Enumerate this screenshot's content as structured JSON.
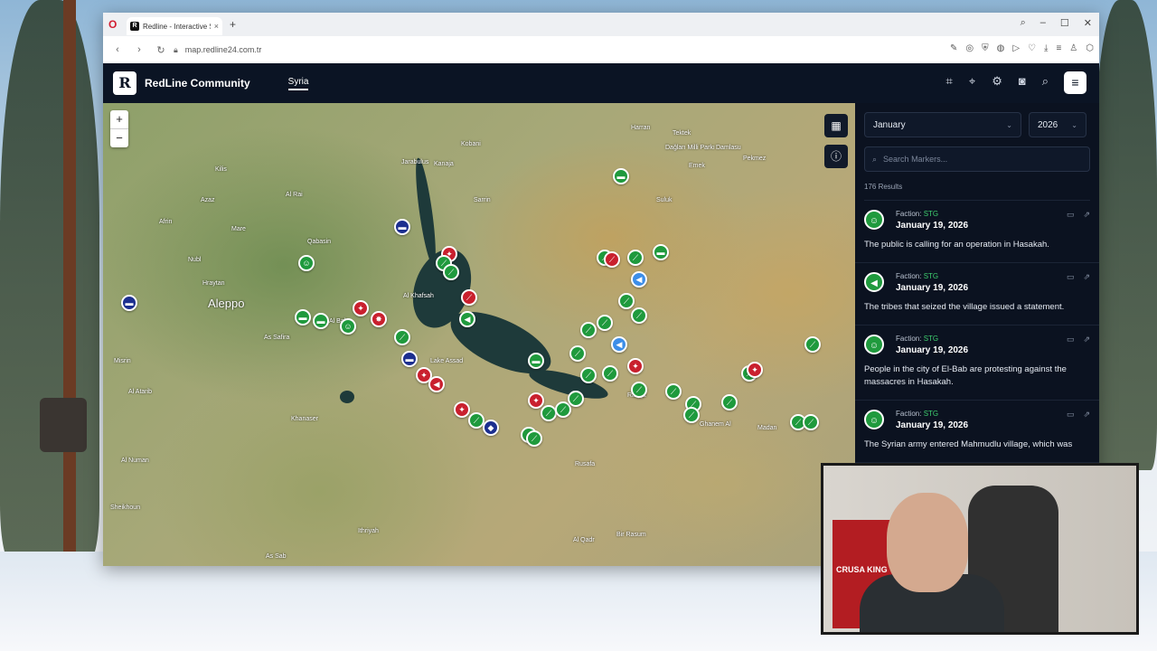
{
  "browser": {
    "tab_title": "Redline - Interactive Strat",
    "url": "map.redline24.com.tr",
    "tab_close": "×",
    "new_tab": "+"
  },
  "app": {
    "brand": "RedLine Community",
    "logo_letter": "R",
    "nav_active": "Syria",
    "map": {
      "zoom_in": "+",
      "zoom_out": "−",
      "cities": [
        {
          "name": "Aleppo",
          "size": "big"
        },
        {
          "name": "Jarabulus"
        },
        {
          "name": "Kobani"
        },
        {
          "name": "Harran"
        },
        {
          "name": "Kanaja"
        },
        {
          "name": "Sarrin"
        },
        {
          "name": "Azaz"
        },
        {
          "name": "Afrin"
        },
        {
          "name": "Kilis"
        },
        {
          "name": "Al Rai"
        },
        {
          "name": "Mare"
        },
        {
          "name": "Qabasin"
        },
        {
          "name": "Nubl"
        },
        {
          "name": "Hraytan"
        },
        {
          "name": "Al Khafsah"
        },
        {
          "name": "Lake Assad"
        },
        {
          "name": "As Safira"
        },
        {
          "name": "Khanaser"
        },
        {
          "name": "Al Bab"
        },
        {
          "name": "Raqqa"
        },
        {
          "name": "Ghanem Al"
        },
        {
          "name": "Madan"
        },
        {
          "name": "Al Qadr"
        },
        {
          "name": "Bir Rasum"
        },
        {
          "name": "Ithriyah"
        },
        {
          "name": "As Sab"
        },
        {
          "name": "Suluk"
        },
        {
          "name": "Emek"
        },
        {
          "name": "Damlasu"
        },
        {
          "name": "Pekmez"
        },
        {
          "name": "Dağları Milli Parkı"
        },
        {
          "name": "Tektek"
        },
        {
          "name": "Al Atarib"
        },
        {
          "name": "Al Numan"
        },
        {
          "name": "Sheikhoun"
        },
        {
          "name": "Misrin"
        },
        {
          "name": "Rusafa"
        }
      ]
    },
    "panel": {
      "month": "January",
      "year": "2026",
      "search_placeholder": "Search Markers...",
      "results": "176 Results",
      "items": [
        {
          "faction_label": "Faction:",
          "faction": "STG",
          "date": "January 19, 2026",
          "text": "The public is calling for an operation in Hasakah.",
          "icon": "people-icon"
        },
        {
          "faction_label": "Faction:",
          "faction": "STG",
          "date": "January 19, 2026",
          "text": "The tribes that seized the village issued a statement.",
          "icon": "megaphone-icon"
        },
        {
          "faction_label": "Faction:",
          "faction": "STG",
          "date": "January 19, 2026",
          "text": "People in the city of El-Bab are protesting against the massacres in Hasakah.",
          "icon": "people-icon"
        },
        {
          "faction_label": "Faction:",
          "faction": "STG",
          "date": "January 19, 2026",
          "text": "The Syrian army entered Mahmudlu village, which was",
          "icon": "people-icon"
        }
      ]
    }
  },
  "webcam": {
    "banner_text": "CRUSA KING"
  }
}
